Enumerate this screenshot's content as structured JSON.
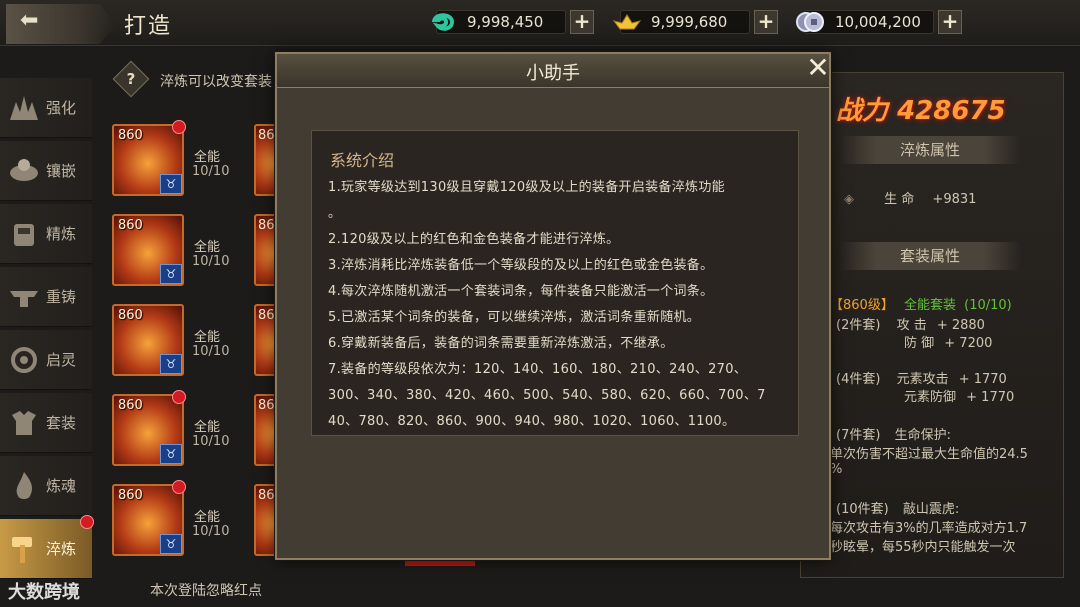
{
  "header": {
    "back_icon": "back-arrow-icon",
    "title": "打造",
    "currencies": [
      {
        "icon": "jade-icon",
        "value": "9,998,450",
        "color": "#2ec4a0"
      },
      {
        "icon": "gold-ingot-icon",
        "value": "9,999,680",
        "color": "#f2c23b"
      },
      {
        "icon": "silver-coin-icon",
        "value": "10,004,200",
        "color": "#b9bed8"
      }
    ]
  },
  "sidebar": {
    "items": [
      {
        "label": "强化",
        "icon": "strengthen-icon"
      },
      {
        "label": "镶嵌",
        "icon": "inlay-icon"
      },
      {
        "label": "精炼",
        "icon": "refine-icon"
      },
      {
        "label": "重铸",
        "icon": "recast-icon"
      },
      {
        "label": "启灵",
        "icon": "spirit-icon"
      },
      {
        "label": "套装",
        "icon": "suit-icon"
      },
      {
        "label": "炼魂",
        "icon": "soul-flame-icon"
      },
      {
        "label": "淬炼",
        "icon": "temper-hammer-icon",
        "active": true
      }
    ]
  },
  "hint": {
    "icon": "question-icon",
    "text": "淬炼可以改变套装"
  },
  "equipment": [
    {
      "level": "860",
      "name": "全能",
      "count": "10/10"
    },
    {
      "level": "860",
      "name": "全能",
      "count": "10/10"
    },
    {
      "level": "860",
      "name": "全能",
      "count": "10/10"
    },
    {
      "level": "860",
      "name": "全能",
      "count": "10/10"
    },
    {
      "level": "860",
      "name": "全能",
      "count": "10/10"
    }
  ],
  "equipment_peek_level": "86",
  "right_panel": {
    "power_label": "战力",
    "power_value": "428675",
    "temper_title": "淬炼属性",
    "temper_attr_name": "生 命",
    "temper_attr_value": "+9831",
    "suit_title": "套装属性",
    "suit_level": "【860级】",
    "suit_name": "全能套装",
    "suit_count": "(10/10)",
    "set2_label": "(2件套)",
    "set2_attr1_name": "攻  击",
    "set2_attr1_value": "+ 2880",
    "set2_attr2_name": "防  御",
    "set2_attr2_value": "+ 7200",
    "set4_label": "(4件套)",
    "set4_attr1_name": "元素攻击",
    "set4_attr1_value": "+ 1770",
    "set4_attr2_name": "元素防御",
    "set4_attr2_value": "+ 1770",
    "set7_label": "(7件套)",
    "set7_name": "生命保护:",
    "set7_desc1": "单次伤害不超过最大生命值的24.5",
    "set7_desc2": "%",
    "set10_label": "(10件套)",
    "set10_name": "敲山震虎:",
    "set10_desc1": "每次攻击有3%的几率造成对方1.7",
    "set10_desc2": "秒眩晕，每55秒内只能触发一次"
  },
  "modal": {
    "title": "小助手",
    "close_icon": "close-icon",
    "section_title": "系统介绍",
    "lines": [
      "1.玩家等级达到130级且穿戴120级及以上的装备开启装备淬炼功能",
      "。",
      "2.120级及以上的红色和金色装备才能进行淬炼。",
      "3.淬炼消耗比淬炼装备低一个等级段的及以上的红色或金色装备。",
      "4.每次淬炼随机激活一个套装词条，每件装备只能激活一个词条。",
      "5.已激活某个词条的装备，可以继续淬炼，激活词条重新随机。",
      "6.穿戴新装备后，装备的词条需要重新淬炼激活，不继承。",
      "7.装备的等级段依次为：120、140、160、180、210、240、270、",
      "300、340、380、420、460、500、540、580、620、660、700、7",
      "40、780、820、860、900、940、980、1020、1060、1100。"
    ]
  },
  "footer": {
    "ignore_text": "本次登陆忽略红点",
    "watermark": "大数跨境"
  }
}
